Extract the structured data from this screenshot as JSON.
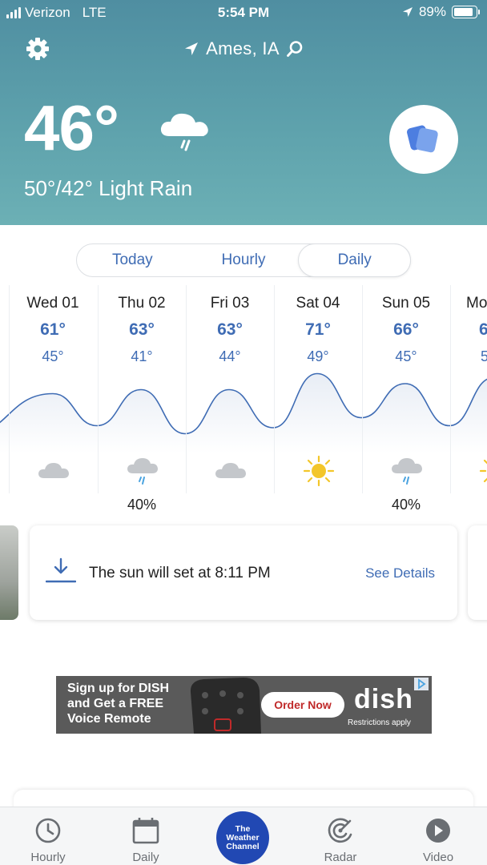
{
  "status_bar": {
    "carrier": "Verizon",
    "network": "LTE",
    "time": "5:54 PM",
    "battery": "89%",
    "battery_level": 0.89
  },
  "header": {
    "location": "Ames, IA",
    "current_temp": "46°",
    "hi_lo_condition": "50°/42° Light Rain",
    "icons": [
      "gear-icon",
      "location-arrow-icon",
      "search-icon",
      "rain-cloud-icon",
      "cards-icon"
    ]
  },
  "tabs": {
    "items": [
      "Today",
      "Hourly",
      "Daily"
    ],
    "selected": "Daily"
  },
  "forecast": {
    "days": [
      {
        "name": "Wed 01",
        "hi": "61°",
        "lo": "45°",
        "icon": "cloudy-icon",
        "precip": ""
      },
      {
        "name": "Thu 02",
        "hi": "63°",
        "lo": "41°",
        "icon": "rain-icon",
        "precip": "40%"
      },
      {
        "name": "Fri 03",
        "hi": "63°",
        "lo": "44°",
        "icon": "cloudy-icon",
        "precip": ""
      },
      {
        "name": "Sat 04",
        "hi": "71°",
        "lo": "49°",
        "icon": "sunny-icon",
        "precip": ""
      },
      {
        "name": "Sun 05",
        "hi": "66°",
        "lo": "45°",
        "icon": "rain-icon",
        "precip": "40%"
      },
      {
        "name": "Mo",
        "hi": "6",
        "lo": "5",
        "icon": "sunny-icon",
        "precip": ""
      }
    ]
  },
  "sun_card": {
    "text": "The sun will set at 8:11 PM",
    "link": "See Details"
  },
  "ad": {
    "line1": "Sign up for DISH",
    "line2": "and Get a FREE",
    "line3": "Voice Remote",
    "cta": "Order Now",
    "brand": "dish",
    "disclaimer": "Restrictions apply"
  },
  "tab_bar": {
    "items": [
      {
        "label": "Hourly",
        "icon": "clock-icon"
      },
      {
        "label": "Daily",
        "icon": "calendar-icon"
      },
      {
        "label": "Radar",
        "icon": "radar-icon"
      },
      {
        "label": "Video",
        "icon": "play-icon"
      }
    ],
    "logo_lines": [
      "The",
      "Weather",
      "Channel"
    ]
  },
  "colors": {
    "header_top": "#4f8ea1",
    "header_bottom": "#6cb0b5",
    "accent_blue": "#3f6cb4",
    "brand_blue": "#2148b3",
    "sun_yellow": "#f3c62a",
    "cloud_gray": "#c4c7cb",
    "rain_blue": "#4aa3e0"
  }
}
